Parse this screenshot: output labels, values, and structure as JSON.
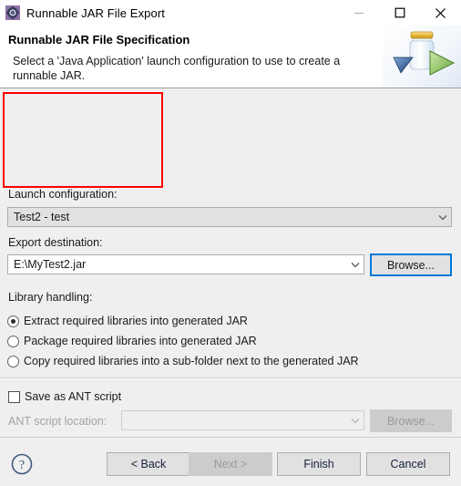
{
  "window": {
    "title": "Runnable JAR File Export",
    "icon": "jar-export-icon",
    "minimize_label": "—",
    "maximize_label": "□",
    "close_label": "×"
  },
  "header": {
    "title": "Runnable JAR File Specification",
    "description": "Select a 'Java Application' launch configuration to use to create a runnable JAR.",
    "art": "jar-with-green-play-arrow"
  },
  "form": {
    "launch_configuration": {
      "label": "Launch configuration:",
      "value": "Test2 - test",
      "arrow": "chevron-down"
    },
    "export_destination": {
      "label": "Export destination:",
      "value": "E:\\MyTest2.jar",
      "arrow": "chevron-down",
      "browse_label": "Browse..."
    },
    "library_handling": {
      "label": "Library handling:",
      "options": [
        {
          "label": "Extract required libraries into generated JAR",
          "selected": true
        },
        {
          "label": "Package required libraries into generated JAR",
          "selected": false
        },
        {
          "label": "Copy required libraries into a sub-folder next to the generated JAR",
          "selected": false
        }
      ]
    },
    "ant": {
      "checkbox_label": "Save as ANT script",
      "checked": false,
      "location_label": "ANT script location:",
      "location_value": "",
      "browse_label": "Browse...",
      "disabled": true
    }
  },
  "footer": {
    "help_label": "?",
    "back_label": "< Back",
    "next_label": "Next >",
    "finish_label": "Finish",
    "cancel_label": "Cancel"
  },
  "colors": {
    "accent_focus": "#0078d7",
    "annotation": "#ff0000",
    "window_bg": "#efeff0",
    "header_bg": "#ffffff"
  }
}
